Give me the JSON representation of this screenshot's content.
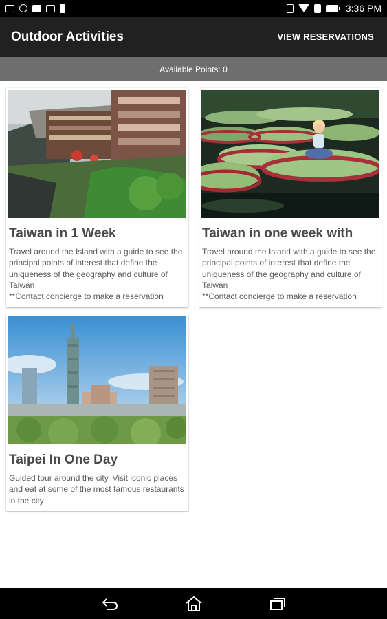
{
  "status_bar": {
    "time": "3:36 PM",
    "left_icons": [
      "image-icon",
      "sync-icon",
      "calendar-icon",
      "photo-icon",
      "figure-icon"
    ],
    "right_icons": [
      "vibrate-icon",
      "wifi-icon",
      "sim-icon",
      "battery-icon"
    ]
  },
  "app_bar": {
    "title": "Outdoor Activities",
    "action_label": "VIEW RESERVATIONS"
  },
  "points_bar": {
    "text": "Available Points: 0"
  },
  "cards": [
    {
      "title": "Taiwan in 1 Week",
      "description": "Travel around the Island with a guide to see the principal points of interest that define the uniqueness of the geography and culture of Taiwan\n**Contact concierge to make a reservation",
      "image": "village-on-hillside-photo"
    },
    {
      "title": "Taiwan in one week with",
      "description": "Travel around the Island with a guide to see the principal points of interest that define the uniqueness of the geography and culture of Taiwan\n**Contact concierge to make a reservation",
      "image": "child-on-lily-pad-photo"
    },
    {
      "title": "Taipei In One Day",
      "description": "Guided tour around the city, Visit iconic places and eat at some of the most famous restaurants in the city",
      "image": "taipei-skyline-photo"
    }
  ],
  "nav_bar": {
    "buttons": [
      "back-icon",
      "home-icon",
      "recents-icon"
    ]
  }
}
